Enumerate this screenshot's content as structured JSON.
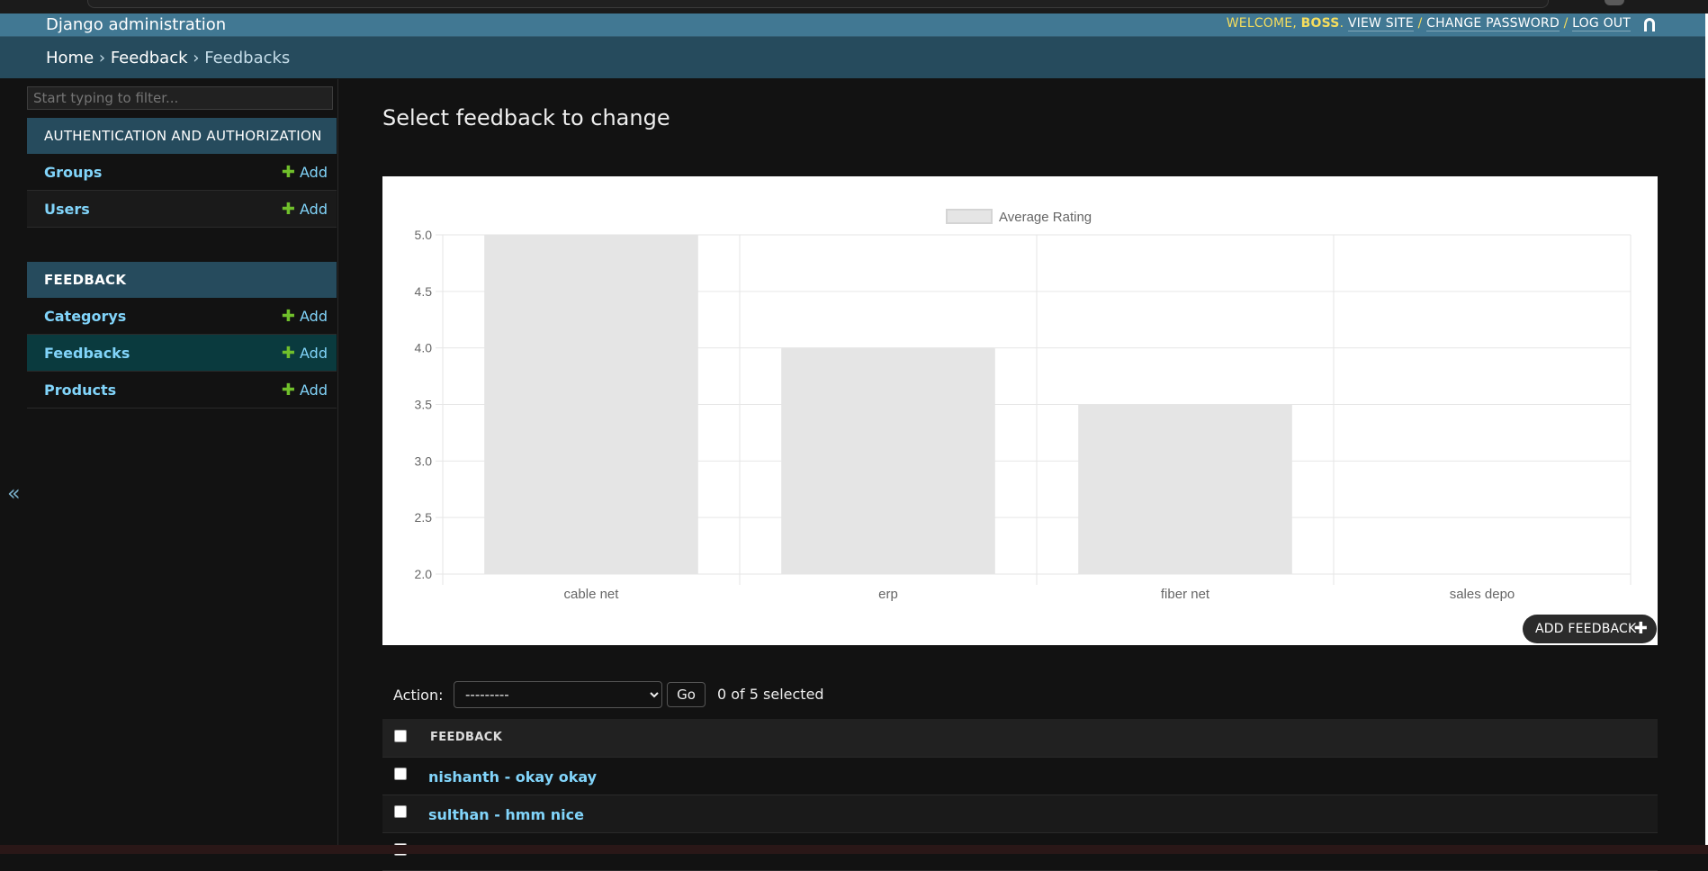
{
  "header": {
    "brand": "Django administration",
    "welcome_prefix": "WELCOME, ",
    "username": "BOSS",
    "welcome_suffix": ".",
    "view_site": "VIEW SITE",
    "change_password": "CHANGE PASSWORD",
    "log_out": "LOG OUT",
    "separator": " / "
  },
  "breadcrumbs": {
    "home": "Home",
    "app": "Feedback",
    "current": "Feedbacks",
    "sep": " › "
  },
  "sidebar": {
    "filter_placeholder": "Start typing to filter...",
    "collapse_glyph": "«",
    "modules": [
      {
        "caption": "AUTHENTICATION AND AUTHORIZATION",
        "rows": [
          {
            "name": "Groups",
            "add": "Add"
          },
          {
            "name": "Users",
            "add": "Add"
          }
        ]
      },
      {
        "caption": "FEEDBACK",
        "rows": [
          {
            "name": "Categorys",
            "add": "Add"
          },
          {
            "name": "Feedbacks",
            "add": "Add"
          },
          {
            "name": "Products",
            "add": "Add"
          }
        ]
      }
    ]
  },
  "main": {
    "title": "Select feedback to change",
    "add_button": "ADD FEEDBACK",
    "actions": {
      "label": "Action:",
      "selected_option": "---------",
      "go": "Go",
      "counter": "0 of 5 selected"
    },
    "table": {
      "column": "FEEDBACK",
      "rows": [
        "nishanth - okay okay",
        "sulthan - hmm nice"
      ]
    }
  },
  "chart_data": {
    "type": "bar",
    "categories": [
      "cable net",
      "erp",
      "fiber net",
      "sales depo"
    ],
    "series": [
      {
        "name": "Average Rating",
        "values": [
          5.0,
          4.0,
          3.5,
          2.0
        ]
      }
    ],
    "ylim": [
      2.0,
      5.0
    ],
    "yticks": [
      "5.0",
      "4.5",
      "4.0",
      "3.5",
      "3.0",
      "2.5",
      "2.0"
    ],
    "grid": true,
    "legend": "top",
    "bar_color": "#e5e5e5",
    "grid_color": "#e6e6e6",
    "tick_color": "#666666"
  },
  "colors": {
    "header": "#417893",
    "breadcrumbs": "#264b5d",
    "link": "#81d4fa",
    "add_plus": "#70bf2b",
    "current_row": "#0a3a3e"
  }
}
